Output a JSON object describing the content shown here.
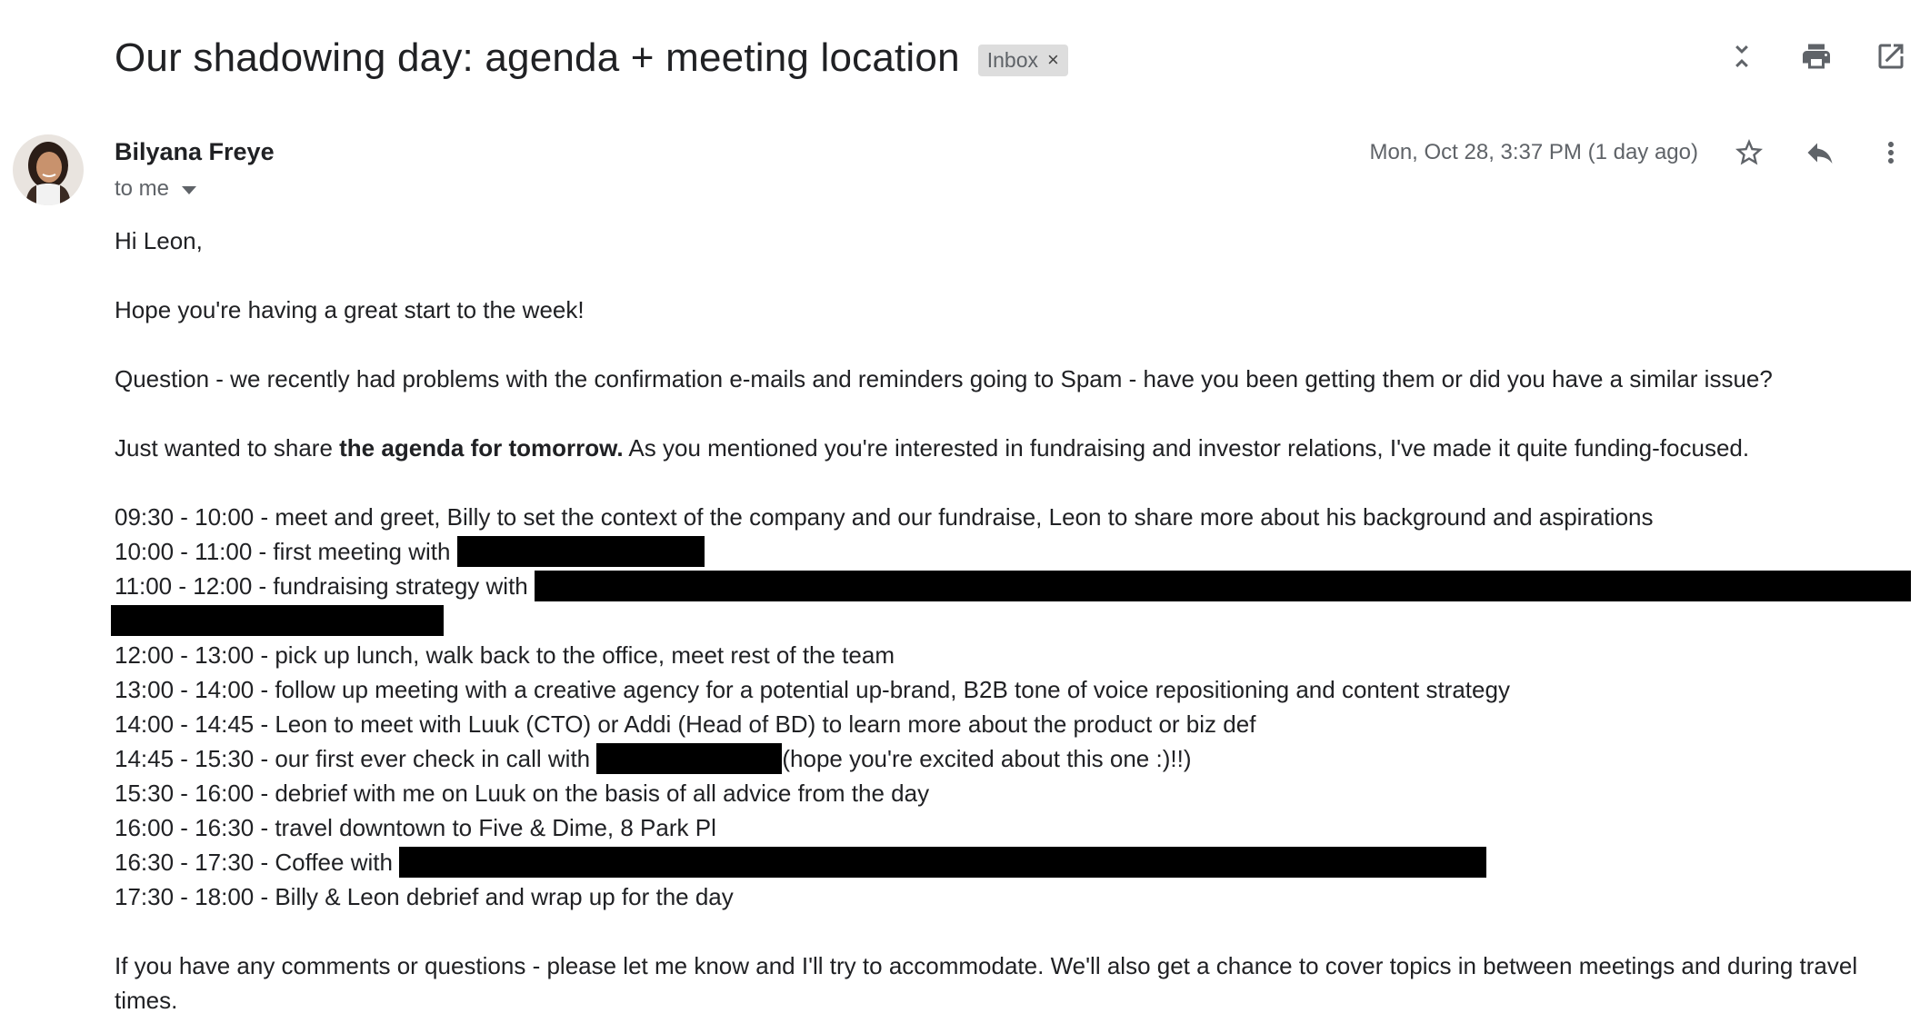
{
  "subject": "Our shadowing day: agenda + meeting location",
  "label_chip": {
    "label": "Inbox",
    "remove": "×"
  },
  "top_actions": [
    "collapse-all-icon",
    "print-icon",
    "open-in-new-window-icon"
  ],
  "sender": {
    "name": "Bilyana Freye",
    "recipients": "to me"
  },
  "date": "Mon, Oct 28, 3:37 PM (1 day ago)",
  "message_actions": [
    "star-icon",
    "reply-icon",
    "more-vert-icon"
  ],
  "body": {
    "greeting": "Hi Leon,",
    "p1": "Hope you're having a great start to the week!",
    "p2": "Question - we recently had problems with the confirmation e-mails and reminders going to Spam - have you been getting them or did you have a similar issue?",
    "p3_pre": "Just wanted to share ",
    "p3_bold": "the agenda for tomorrow.",
    "p3_post": " As you mentioned you're interested in fundraising and investor relations, I've made it quite funding-focused.",
    "agenda": [
      "09:30 - 10:00 - meet and greet, Billy to set the context of the company and our fundraise, Leon to share more about his background and aspirations",
      "10:00 - 11:00 - first meeting with ",
      "11:00 - 12:00 - fundraising strategy with ",
      "12:00 - 13:00 - pick up lunch, walk back to the office, meet rest of the team",
      "13:00 - 14:00 - follow up meeting with a creative agency for a potential up-brand, B2B tone of voice repositioning and content strategy",
      "14:00 - 14:45 - Leon to meet with Luuk (CTO) or Addi (Head of BD) to learn more about the product or biz def",
      "14:45 - 15:30 - our first ever check in call with ",
      "15:30 - 16:00 - debrief with me on Luuk on the basis of all advice from the day",
      "16:00 - 16:30 - travel downtown to Five & Dime, 8 Park Pl",
      "16:30 - 17:30 - Coffee with ",
      "17:30 - 18:00 - Billy & Leon debrief and wrap up for the day"
    ],
    "agenda_1445_suffix": "(hope you're excited about this one :)!!)",
    "closing": "If you have any comments or questions - please let me know and I'll try to accommodate. We'll also get a chance to cover topics in between meetings and during travel times."
  }
}
